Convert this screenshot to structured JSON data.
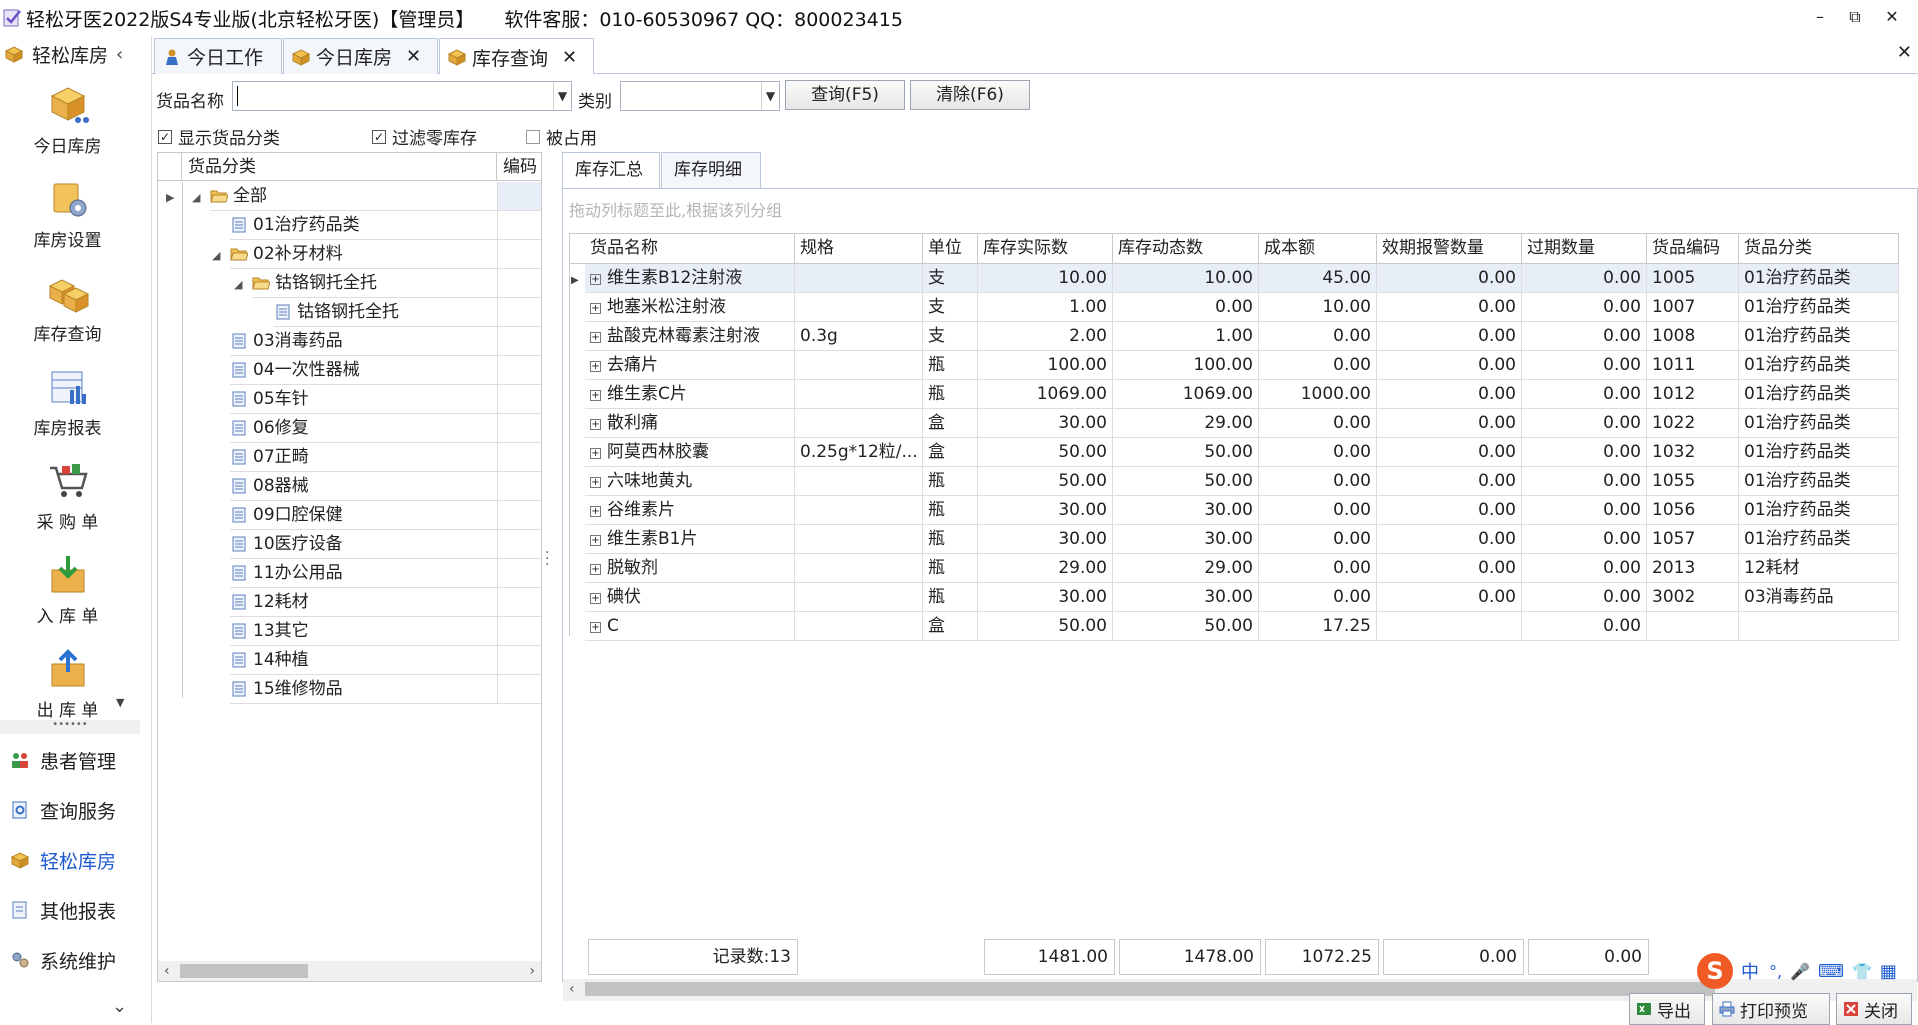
{
  "window": {
    "title": "轻松牙医2022版S4专业版(北京轻松牙医)【管理员】",
    "support": "软件客服：010-60530967 QQ：800023415",
    "minimize": "–",
    "restore": "⧉",
    "close": "✕"
  },
  "leftnav": {
    "header": "轻松库房",
    "collapse": "‹",
    "big_items": [
      {
        "label": "今日库房"
      },
      {
        "label": "库房设置"
      },
      {
        "label": "库存查询"
      },
      {
        "label": "库房报表"
      },
      {
        "label": "采 购 单"
      },
      {
        "label": "入 库 单"
      },
      {
        "label": "出 库 单"
      }
    ],
    "more_arrow": "▼",
    "grip": "••••••",
    "small_items": [
      {
        "label": "患者管理"
      },
      {
        "label": "查询服务"
      },
      {
        "label": "轻松库房"
      },
      {
        "label": "其他报表"
      },
      {
        "label": "系统维护"
      }
    ],
    "bottom_arrow": "⌄"
  },
  "tabs": [
    {
      "label": "今日工作"
    },
    {
      "label": "今日库房",
      "close": "✕"
    },
    {
      "label": "库存查询",
      "close": "✕"
    }
  ],
  "tabs_close_all": "✕",
  "filters": {
    "name_label": "货品名称",
    "name_value": "",
    "category_label": "类别",
    "category_value": "",
    "query_button": "查询(F5)",
    "clear_button": "清除(F6)",
    "show_category": {
      "label": "显示货品分类",
      "checked": true
    },
    "filter_zero": {
      "label": "过滤零库存",
      "checked": true
    },
    "occupied": {
      "label": "被占用",
      "checked": false
    }
  },
  "tree": {
    "col_category": "货品分类",
    "col_code": "编码",
    "nodes": [
      {
        "label": "全部",
        "level": 0,
        "folder": true
      },
      {
        "label": "01治疗药品类",
        "level": 1,
        "folder": false
      },
      {
        "label": "02补牙材料",
        "level": 1,
        "folder": true
      },
      {
        "label": "钴铬钢托全托",
        "level": 2,
        "folder": true
      },
      {
        "label": "钴铬钢托全托",
        "level": 3,
        "folder": false
      },
      {
        "label": "03消毒药品",
        "level": 1,
        "folder": false
      },
      {
        "label": "04一次性器械",
        "level": 1,
        "folder": false
      },
      {
        "label": "05车针",
        "level": 1,
        "folder": false
      },
      {
        "label": "06修复",
        "level": 1,
        "folder": false
      },
      {
        "label": "07正畸",
        "level": 1,
        "folder": false
      },
      {
        "label": "08器械",
        "level": 1,
        "folder": false
      },
      {
        "label": "09口腔保健",
        "level": 1,
        "folder": false
      },
      {
        "label": "10医疗设备",
        "level": 1,
        "folder": false
      },
      {
        "label": "11办公用品",
        "level": 1,
        "folder": false
      },
      {
        "label": "12耗材",
        "level": 1,
        "folder": false
      },
      {
        "label": "13其它",
        "level": 1,
        "folder": false
      },
      {
        "label": "14种植",
        "level": 1,
        "folder": false
      },
      {
        "label": "15维修物品",
        "level": 1,
        "folder": false
      }
    ]
  },
  "subtabs": [
    {
      "label": "库存汇总"
    },
    {
      "label": "库存明细"
    }
  ],
  "grid": {
    "group_hint": "拖动列标题至此,根据该列分组",
    "columns": [
      "货品名称",
      "规格",
      "单位",
      "库存实际数",
      "库存动态数",
      "成本额",
      "效期报警数量",
      "过期数量",
      "货品编码",
      "货品分类"
    ],
    "rows": [
      [
        "维生素B12注射液",
        "",
        "支",
        "10.00",
        "10.00",
        "45.00",
        "0.00",
        "0.00",
        "1005",
        "01治疗药品类"
      ],
      [
        "地塞米松注射液",
        "",
        "支",
        "1.00",
        "0.00",
        "10.00",
        "0.00",
        "0.00",
        "1007",
        "01治疗药品类"
      ],
      [
        "盐酸克林霉素注射液",
        "0.3g",
        "支",
        "2.00",
        "1.00",
        "0.00",
        "0.00",
        "0.00",
        "1008",
        "01治疗药品类"
      ],
      [
        "去痛片",
        "",
        "瓶",
        "100.00",
        "100.00",
        "0.00",
        "0.00",
        "0.00",
        "1011",
        "01治疗药品类"
      ],
      [
        "维生素C片",
        "",
        "瓶",
        "1069.00",
        "1069.00",
        "1000.00",
        "0.00",
        "0.00",
        "1012",
        "01治疗药品类"
      ],
      [
        "散利痛",
        "",
        "盒",
        "30.00",
        "29.00",
        "0.00",
        "0.00",
        "0.00",
        "1022",
        "01治疗药品类"
      ],
      [
        "阿莫西林胶囊",
        "0.25g*12粒/...",
        "盒",
        "50.00",
        "50.00",
        "0.00",
        "0.00",
        "0.00",
        "1032",
        "01治疗药品类"
      ],
      [
        "六味地黄丸",
        "",
        "瓶",
        "50.00",
        "50.00",
        "0.00",
        "0.00",
        "0.00",
        "1055",
        "01治疗药品类"
      ],
      [
        "谷维素片",
        "",
        "瓶",
        "30.00",
        "30.00",
        "0.00",
        "0.00",
        "0.00",
        "1056",
        "01治疗药品类"
      ],
      [
        "维生素B1片",
        "",
        "瓶",
        "30.00",
        "30.00",
        "0.00",
        "0.00",
        "0.00",
        "1057",
        "01治疗药品类"
      ],
      [
        "脱敏剂",
        "",
        "瓶",
        "29.00",
        "29.00",
        "0.00",
        "0.00",
        "0.00",
        "2013",
        "12耗材"
      ],
      [
        "碘伏",
        "",
        "瓶",
        "30.00",
        "30.00",
        "0.00",
        "0.00",
        "0.00",
        "3002",
        "03消毒药品"
      ],
      [
        "C",
        "",
        "盒",
        "50.00",
        "50.00",
        "17.25",
        "",
        "0.00",
        "",
        ""
      ]
    ],
    "footer": {
      "records": "记录数:13",
      "actual": "1481.00",
      "dynamic": "1478.00",
      "cost": "1072.25",
      "alert": "0.00",
      "expired": "0.00"
    }
  },
  "bottom": {
    "export": "导出",
    "print_preview": "打印预览",
    "close": "关闭"
  },
  "ime": {
    "logo": "S",
    "mode": "中",
    "punct": "°,",
    "mic": "🎤",
    "kbd": "⌨",
    "skin": "👕",
    "grid": "▦"
  },
  "colors": {
    "accent_blue": "#1e5bd0",
    "tab_border": "#b9c7d9",
    "selected_row": "#e7eef8",
    "ime_orange": "#f05a24"
  }
}
